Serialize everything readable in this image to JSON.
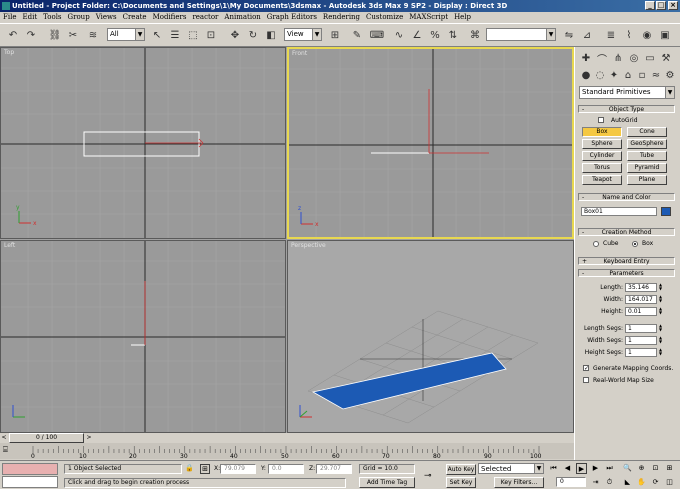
{
  "window": {
    "title": "Untitled    - Project Folder: C:\\Documents and Settings\\1\\My Documents\\3dsmax    - Autodesk 3ds Max 9 SP2    - Display : Direct 3D"
  },
  "menu": [
    "File",
    "Edit",
    "Tools",
    "Group",
    "Views",
    "Create",
    "Modifiers",
    "reactor",
    "Animation",
    "Graph Editors",
    "Rendering",
    "Customize",
    "MAXScript",
    "Help"
  ],
  "toolbar": {
    "filter_value": "All",
    "refcoord_value": "View"
  },
  "viewports": {
    "top": "Top",
    "front": "Front",
    "left": "Left",
    "perspective": "Perspective"
  },
  "command_panel": {
    "category_value": "Standard Primitives",
    "object_type": {
      "title": "Object Type",
      "autogrid_label": "AutoGrid",
      "buttons": [
        "Box",
        "Cone",
        "Sphere",
        "GeoSphere",
        "Cylinder",
        "Tube",
        "Torus",
        "Pyramid",
        "Teapot",
        "Plane"
      ],
      "active": "Box"
    },
    "name_color": {
      "title": "Name and Color",
      "name_value": "Box01",
      "color": "#1c5ab4"
    },
    "creation_method": {
      "title": "Creation Method",
      "cube_label": "Cube",
      "box_label": "Box",
      "selected": "Box"
    },
    "keyboard_entry": {
      "title": "Keyboard Entry"
    },
    "parameters": {
      "title": "Parameters",
      "length_label": "Length:",
      "length_value": "35.146",
      "width_label": "Width:",
      "width_value": "164.017",
      "height_label": "Height:",
      "height_value": "0.01",
      "length_segs_label": "Length Segs:",
      "length_segs_value": "1",
      "width_segs_label": "Width Segs:",
      "width_segs_value": "1",
      "height_segs_label": "Height Segs:",
      "height_segs_value": "1",
      "gen_mapping_label": "Generate Mapping Coords.",
      "gen_mapping_checked": true,
      "realworld_label": "Real-World Map Size",
      "realworld_checked": false
    }
  },
  "timeline": {
    "slider_label": "0 / 100",
    "ticks": [
      "0",
      "10",
      "20",
      "30",
      "40",
      "50",
      "60",
      "70",
      "80",
      "90",
      "100"
    ]
  },
  "status": {
    "selection": "1 Object Selected",
    "prompt": "Click and drag to begin creation process",
    "x_label": "X:",
    "x_value": "79.079",
    "y_label": "Y:",
    "y_value": "0.0",
    "z_label": "Z:",
    "z_value": "29.707",
    "grid": "Grid = 10.0",
    "add_time_tag": "Add Time Tag",
    "auto_key": "Auto Key",
    "set_key": "Set Key",
    "key_mode_value": "Selected",
    "key_filters": "Key Filters...",
    "frame_value": "0"
  }
}
